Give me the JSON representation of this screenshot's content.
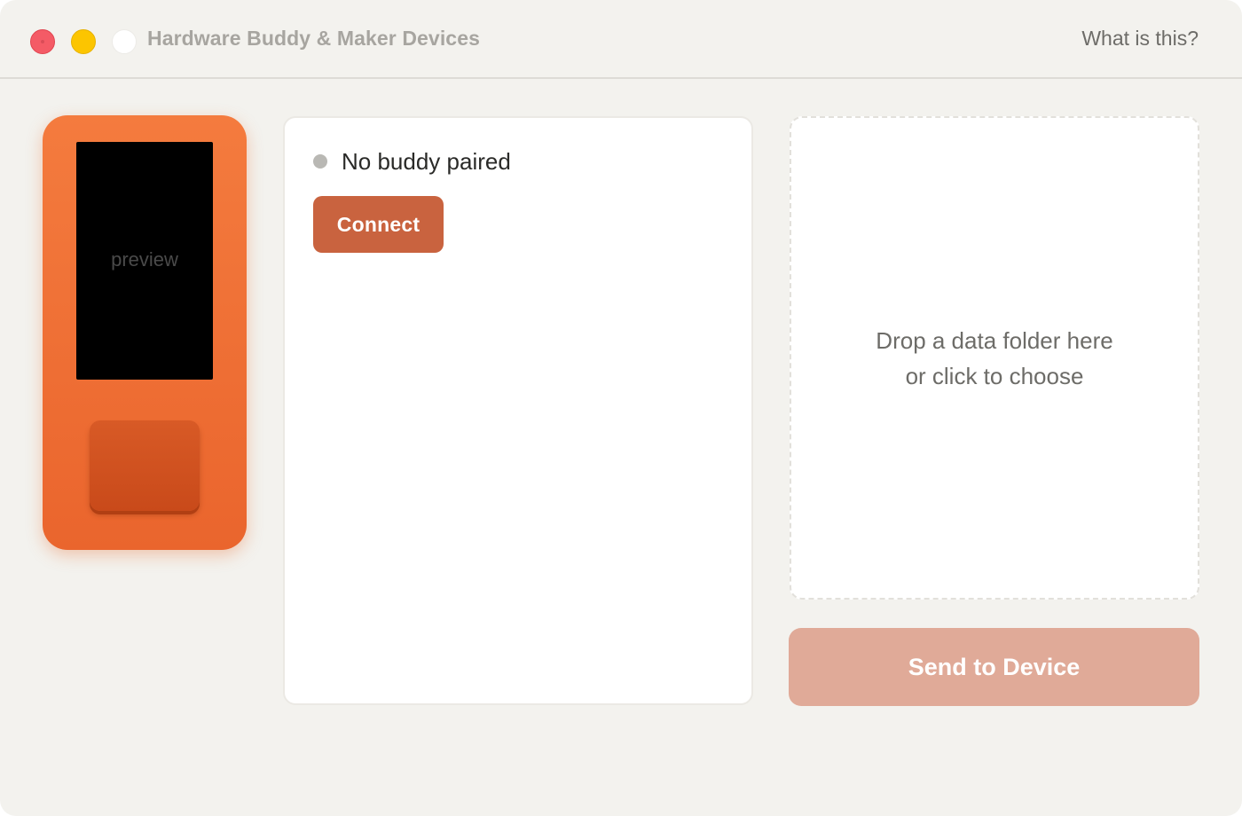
{
  "window": {
    "title": "Hardware Buddy & Maker Devices",
    "help_link": "What is this?"
  },
  "device": {
    "screen_label": "preview"
  },
  "status": {
    "text": "No buddy paired",
    "connect_label": "Connect"
  },
  "dropzone": {
    "line1": "Drop a data folder here",
    "line2": "or click to choose"
  },
  "actions": {
    "send_label": "Send to Device"
  },
  "colors": {
    "accent": "#c9633f",
    "device_orange": "#f47b3e",
    "send_disabled": "#e0aa98",
    "status_dot": "#b9b8b4"
  }
}
